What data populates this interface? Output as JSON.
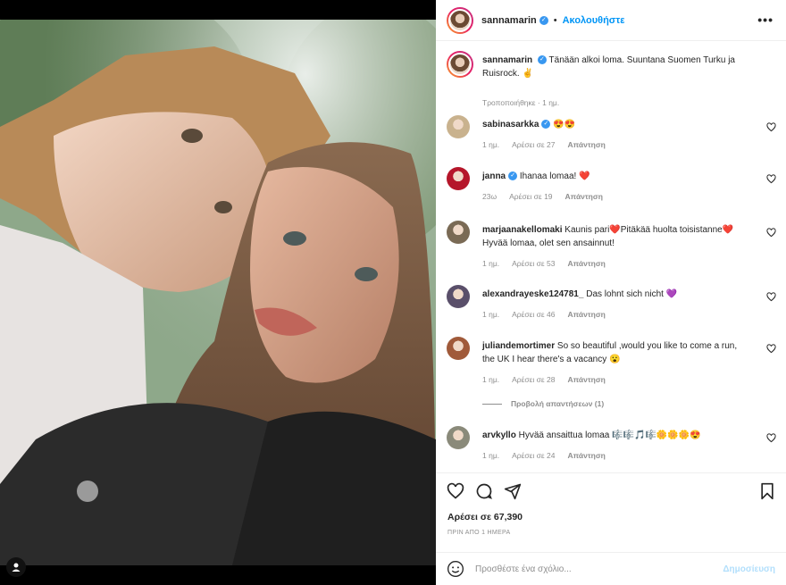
{
  "post": {
    "username": "sannamarin",
    "follow_label": "Ακολουθήστε",
    "more_icon": "ellipsis-icon",
    "caption": "Tänään alkoi loma. Suuntana Suomen Turku ja Ruisrock. ✌️",
    "caption_meta": "Τροποποιήθηκε · 1 ημ.",
    "likes": "Αρέσει σε 67,390",
    "time_ago": "ΠΡΙΝ ΑΠΟ 1 ΗΜΕΡΑ"
  },
  "comments": [
    {
      "user": "sabinasarkka",
      "verified": true,
      "text": "😍😍",
      "meta_time": "1 ημ.",
      "meta_likes": "Αρέσει σε 27",
      "reply": "Απάντηση",
      "avatar_color": "#c9b28e"
    },
    {
      "user": "janna",
      "verified": true,
      "text": "Ihanaa lomaa! ❤️",
      "meta_time": "23ω",
      "meta_likes": "Αρέσει σε 19",
      "reply": "Απάντηση",
      "avatar_color": "#b5162a"
    },
    {
      "user": "marjaanakellomaki",
      "verified": false,
      "text": "Kaunis pari❤️Pitäkää huolta toisistanne❤️ Hyvää lomaa, olet sen ansainnut!",
      "meta_time": "1 ημ.",
      "meta_likes": "Αρέσει σε 53",
      "reply": "Απάντηση",
      "avatar_color": "#7a6a55"
    },
    {
      "user": "alexandrayeske124781_",
      "verified": false,
      "text": "Das lohnt sich nicht 💜",
      "meta_time": "1 ημ.",
      "meta_likes": "Αρέσει σε 46",
      "reply": "Απάντηση",
      "avatar_color": "#5a4f6a"
    },
    {
      "user": "juliandemortimer",
      "verified": false,
      "text": "So so beautiful ,would you like to come a run, the UK I hear there's a vacancy 😮",
      "meta_time": "1 ημ.",
      "meta_likes": "Αρέσει σε 28",
      "reply": "Απάντηση",
      "avatar_color": "#a05a3a"
    },
    {
      "user": "arvkyllo",
      "verified": false,
      "text": "Hyvää ansaittua lomaa 🎼🎼🎵🎼🌼🌼🌼😍",
      "meta_time": "1 ημ.",
      "meta_likes": "Αρέσει σε 24",
      "reply": "Απάντηση",
      "avatar_color": "#8a8a7a"
    }
  ],
  "view_replies": "Προβολή απαντήσεων (1)",
  "add_comment": {
    "placeholder": "Προσθέστε ένα σχόλιο...",
    "post_label": "Δημοσίευση"
  },
  "colors": {
    "accent": "#0095f6",
    "verified": "#3897f0"
  }
}
